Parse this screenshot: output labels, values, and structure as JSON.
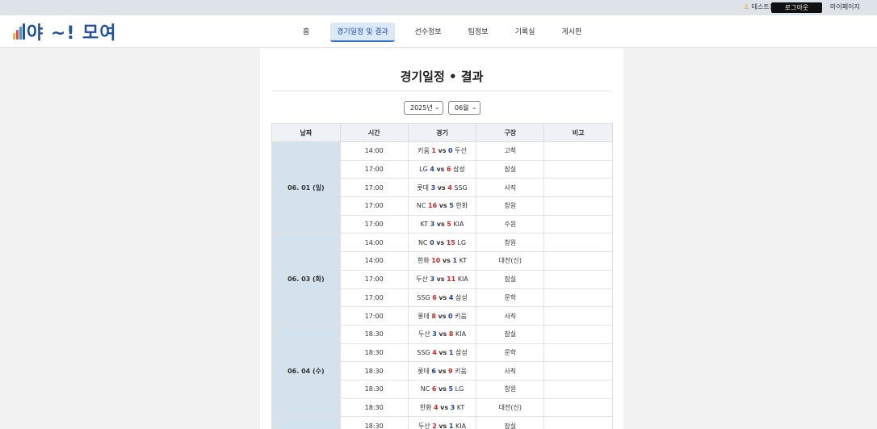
{
  "topbar": {
    "user_label": "테스트용 님",
    "logout_label": "로그아웃",
    "mypage_label": "마이페이지"
  },
  "logo": {
    "text": "야 ~! 모여"
  },
  "nav": [
    {
      "label": "홈",
      "active": false
    },
    {
      "label": "경기일정 및 결과",
      "active": true
    },
    {
      "label": "선수정보",
      "active": false
    },
    {
      "label": "팀정보",
      "active": false
    },
    {
      "label": "기록실",
      "active": false
    },
    {
      "label": "게시판",
      "active": false
    }
  ],
  "page": {
    "title": "경기일정 • 결과"
  },
  "filters": {
    "year": "2025년",
    "month": "06월"
  },
  "table": {
    "headers": [
      "날짜",
      "시간",
      "경기",
      "구장",
      "비고"
    ],
    "groups": [
      {
        "date": "06. 01 (일)",
        "games": [
          {
            "time": "14:00",
            "home": "키움",
            "home_score": "1",
            "away_score": "0",
            "away": "두산",
            "stadium": "고척",
            "note": ""
          },
          {
            "time": "17:00",
            "home": "LG",
            "home_score": "4",
            "away_score": "6",
            "away": "삼성",
            "stadium": "잠실",
            "note": ""
          },
          {
            "time": "17:00",
            "home": "롯데",
            "home_score": "3",
            "away_score": "4",
            "away": "SSG",
            "stadium": "사직",
            "note": ""
          },
          {
            "time": "17:00",
            "home": "NC",
            "home_score": "16",
            "away_score": "5",
            "away": "한화",
            "stadium": "창원",
            "note": ""
          },
          {
            "time": "17:00",
            "home": "KT",
            "home_score": "3",
            "away_score": "5",
            "away": "KIA",
            "stadium": "수원",
            "note": ""
          }
        ]
      },
      {
        "date": "06. 03 (화)",
        "games": [
          {
            "time": "14:00",
            "home": "NC",
            "home_score": "0",
            "away_score": "15",
            "away": "LG",
            "stadium": "창원",
            "note": ""
          },
          {
            "time": "14:00",
            "home": "한화",
            "home_score": "10",
            "away_score": "1",
            "away": "KT",
            "stadium": "대전(신)",
            "note": ""
          },
          {
            "time": "17:00",
            "home": "두산",
            "home_score": "3",
            "away_score": "11",
            "away": "KIA",
            "stadium": "잠실",
            "note": ""
          },
          {
            "time": "17:00",
            "home": "SSG",
            "home_score": "6",
            "away_score": "4",
            "away": "삼성",
            "stadium": "문학",
            "note": ""
          },
          {
            "time": "17:00",
            "home": "롯데",
            "home_score": "8",
            "away_score": "0",
            "away": "키움",
            "stadium": "사직",
            "note": ""
          }
        ]
      },
      {
        "date": "06. 04 (수)",
        "games": [
          {
            "time": "18:30",
            "home": "두산",
            "home_score": "3",
            "away_score": "8",
            "away": "KIA",
            "stadium": "잠실",
            "note": ""
          },
          {
            "time": "18:30",
            "home": "SSG",
            "home_score": "4",
            "away_score": "1",
            "away": "삼성",
            "stadium": "문학",
            "note": ""
          },
          {
            "time": "18:30",
            "home": "롯데",
            "home_score": "6",
            "away_score": "9",
            "away": "키움",
            "stadium": "사직",
            "note": ""
          },
          {
            "time": "18:30",
            "home": "NC",
            "home_score": "6",
            "away_score": "5",
            "away": "LG",
            "stadium": "창원",
            "note": ""
          },
          {
            "time": "18:30",
            "home": "한화",
            "home_score": "4",
            "away_score": "3",
            "away": "KT",
            "stadium": "대전(신)",
            "note": ""
          }
        ]
      },
      {
        "date": "",
        "games": [
          {
            "time": "18:30",
            "home": "두산",
            "home_score": "2",
            "away_score": "1",
            "away": "KIA",
            "stadium": "잠실",
            "note": ""
          }
        ]
      }
    ]
  },
  "colors": {
    "win": "#e2231a",
    "lose": "#1a3fb5",
    "brand": "#1f4fa8",
    "date_bg": "#d4e2ee"
  }
}
